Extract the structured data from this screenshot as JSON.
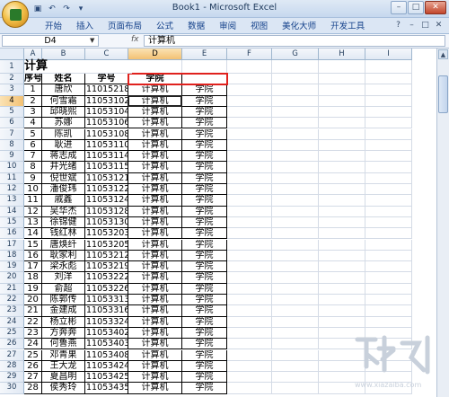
{
  "title_bar": {
    "title": "Book1 - Microsoft Excel",
    "buttons": {
      "minimize": "–",
      "maximize": "□",
      "close": "✕"
    }
  },
  "quick_access": {
    "save_icon": "save-icon",
    "undo_icon": "undo-icon",
    "redo_icon": "redo-icon"
  },
  "ribbon": {
    "tabs": [
      "开始",
      "插入",
      "页面布局",
      "公式",
      "数据",
      "审阅",
      "视图",
      "美化大师",
      "开发工具"
    ],
    "help_icon": "help-icon"
  },
  "formula_bar": {
    "name_box": "D4",
    "fx_label": "fx",
    "formula": "计算机"
  },
  "columns": [
    "A",
    "B",
    "C",
    "D",
    "E",
    "F",
    "G",
    "H",
    "I"
  ],
  "sheet": {
    "title": "计算",
    "headers": [
      "序号",
      "姓名",
      "学号",
      "学院",
      ""
    ],
    "rows": [
      [
        "1",
        "唐欣",
        "11015218",
        "计算机",
        "学院"
      ],
      [
        "2",
        "何雪霜",
        "11053102",
        "计算机",
        "学院"
      ],
      [
        "3",
        "邱晓熙",
        "11053104",
        "计算机",
        "学院"
      ],
      [
        "4",
        "苏娜",
        "11053106",
        "计算机",
        "学院"
      ],
      [
        "5",
        "陈凯",
        "11053108",
        "计算机",
        "学院"
      ],
      [
        "6",
        "耿进",
        "11053110",
        "计算机",
        "学院"
      ],
      [
        "7",
        "蒋志成",
        "11053114",
        "计算机",
        "学院"
      ],
      [
        "8",
        "井光绪",
        "11053115",
        "计算机",
        "学院"
      ],
      [
        "9",
        "倪世斌",
        "11053121",
        "计算机",
        "学院"
      ],
      [
        "10",
        "潘俊玮",
        "11053122",
        "计算机",
        "学院"
      ],
      [
        "11",
        "戚鑫",
        "11053124",
        "计算机",
        "学院"
      ],
      [
        "12",
        "吴华杰",
        "11053128",
        "计算机",
        "学院"
      ],
      [
        "13",
        "徐锦健",
        "11053130",
        "计算机",
        "学院"
      ],
      [
        "14",
        "钱红林",
        "11053203",
        "计算机",
        "学院"
      ],
      [
        "15",
        "唐焕纤",
        "11053205",
        "计算机",
        "学院"
      ],
      [
        "16",
        "耿家利",
        "11053212",
        "计算机",
        "学院"
      ],
      [
        "17",
        "梁永彪",
        "11053219",
        "计算机",
        "学院"
      ],
      [
        "18",
        "刘洋",
        "11053222",
        "计算机",
        "学院"
      ],
      [
        "19",
        "俞超",
        "11053226",
        "计算机",
        "学院"
      ],
      [
        "20",
        "陈郭传",
        "11053313",
        "计算机",
        "学院"
      ],
      [
        "21",
        "金建成",
        "11053316",
        "计算机",
        "学院"
      ],
      [
        "22",
        "杨立彬",
        "11053324",
        "计算机",
        "学院"
      ],
      [
        "23",
        "方奔奔",
        "11053402",
        "计算机",
        "学院"
      ],
      [
        "24",
        "何鲁燕",
        "11053403",
        "计算机",
        "学院"
      ],
      [
        "25",
        "邓青果",
        "11053408",
        "计算机",
        "学院"
      ],
      [
        "26",
        "王大龙",
        "11053424",
        "计算机",
        "学院"
      ],
      [
        "27",
        "夏昌明",
        "11053425",
        "计算机",
        "学院"
      ],
      [
        "28",
        "侯秀玲",
        "11053435",
        "计算机",
        "学院"
      ]
    ]
  },
  "watermark": {
    "text": "www.xiazaiba.com"
  },
  "colors": {
    "highlight_border": "#e0211d",
    "selected_header": "#f3c173",
    "ribbon": "#dbe6f4"
  }
}
